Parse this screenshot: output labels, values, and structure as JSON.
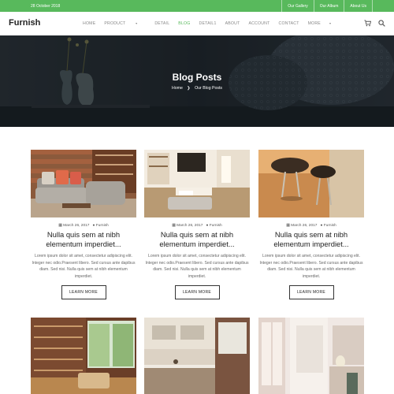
{
  "topbar": {
    "date": "28 October 2018",
    "links": [
      "Our Gallery",
      "Our Album",
      "About Us"
    ]
  },
  "nav": {
    "logo": "Furnish",
    "menu": [
      "HOME",
      "PRODUCT",
      "DETAIL",
      "BLOG",
      "DETAIL1",
      "ABOUT",
      "ACCOUNT",
      "CONTACT",
      "MORE"
    ],
    "active_item": "BLOG",
    "icons": [
      "cart-icon",
      "search-icon"
    ]
  },
  "hero": {
    "title": "Blog Posts",
    "breadcrumb_home": "Home",
    "breadcrumb_sep": "❯",
    "breadcrumb_current": "Our Blog Posts"
  },
  "posts": [
    {
      "date": "March 26, 2017",
      "author": "Furnish",
      "title": "Nulla quis sem at nibh elementum imperdiet...",
      "excerpt": "Lorem ipsum dolor sit amet, consectetur adipiscing elit. Integer nec odio.Praesent libero. Sed cursus ante dapibus diam. Sed nisi. Nulla quis sem at nibh elementum imperdiet.",
      "button": "LEARN MORE"
    },
    {
      "date": "March 26, 2017",
      "author": "Furnish",
      "title": "Nulla quis sem at nibh elementum imperdiet...",
      "excerpt": "Lorem ipsum dolor sit amet, consectetur adipiscing elit. Integer nec odio.Praesent libero. Sed cursus ante dapibus diam. Sed nisi. Nulla quis sem at nibh elementum imperdiet.",
      "button": "LEARN MORE"
    },
    {
      "date": "March 26, 2017",
      "author": "Furnish",
      "title": "Nulla quis sem at nibh elementum imperdiet...",
      "excerpt": "Lorem ipsum dolor sit amet, consectetur adipiscing elit. Integer nec odio.Praesent libero. Sed cursus ante dapibus diam. Sed nisi. Nulla quis sem at nibh elementum imperdiet.",
      "button": "LEARN MORE"
    }
  ],
  "colors": {
    "accent": "#58b95c",
    "hero_bg": "#1f252b"
  }
}
